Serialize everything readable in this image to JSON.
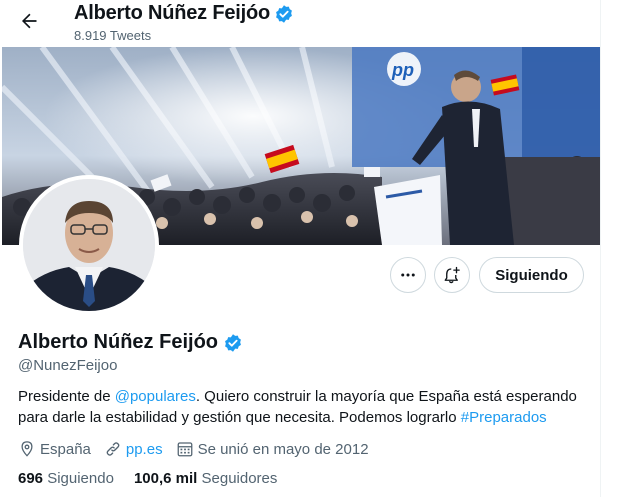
{
  "header": {
    "name": "Alberto Núñez Feijóo",
    "tweet_count": "8.919 Tweets"
  },
  "banner": {
    "logo_text": "pp"
  },
  "actions": {
    "more_icon": "more-horizontal-icon",
    "notify_icon": "bell-plus-icon",
    "follow_label": "Siguiendo"
  },
  "profile": {
    "name": "Alberto Núñez Feijóo",
    "handle": "@NunezFeijoo",
    "bio_prefix": "Presidente de ",
    "bio_mention": "@populares",
    "bio_middle": ". Quiero construir la mayoría que España está esperando para darle la estabilidad y gestión que necesita. Podemos lograrlo ",
    "bio_hashtag": "#Preparados",
    "location": "España",
    "website": "pp.es",
    "joined": "Se unió en mayo de 2012",
    "following_count": "696",
    "following_label": "Siguiendo",
    "followers_count": "100,6 mil",
    "followers_label": "Seguidores"
  },
  "colors": {
    "accent": "#1d9bf0",
    "text": "#0f1419",
    "secondary": "#536471",
    "border": "#cfd9de"
  }
}
